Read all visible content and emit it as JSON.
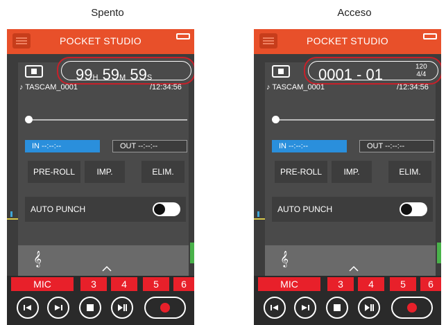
{
  "captions": {
    "left": "Spento",
    "right": "Acceso"
  },
  "app": {
    "title": "POCKET STUDIO"
  },
  "left": {
    "display": {
      "h": "99",
      "h_unit": "H",
      "m": "59",
      "m_unit": "M",
      "s": "59",
      "s_unit": "S"
    },
    "filename": "♪ TASCAM_0001",
    "filetime": "/12:34:56",
    "in_label": "IN  --:--:--",
    "out_label": "OUT  --:--:--",
    "buttons": {
      "preroll": "PRE-ROLL",
      "imp": "IMP.",
      "elim": "ELIM."
    },
    "auto_punch": "AUTO PUNCH",
    "tracks": {
      "mic": "MIC",
      "t3": "3",
      "t4": "4",
      "t5": "5",
      "t6": "6"
    }
  },
  "right": {
    "display": {
      "bar": "0001 - 01",
      "tempo": "120",
      "meter": "4/4"
    },
    "filename": "♪ TASCAM_0001",
    "filetime": "/12:34:56",
    "in_label": "IN  --:--:--",
    "out_label": "OUT  --:--:--",
    "buttons": {
      "preroll": "PRE-ROLL",
      "imp": "IMP.",
      "elim": "ELIM."
    },
    "auto_punch": "AUTO PUNCH",
    "tracks": {
      "mic": "MIC",
      "t3": "3",
      "t4": "4",
      "t5": "5",
      "t6": "6"
    }
  },
  "colors": {
    "accent": "#e8502a",
    "highlight": "#c8202a",
    "in_active": "#2a8fdc",
    "rec": "#e8202a"
  },
  "icons": [
    "menu-icon",
    "battery-icon",
    "stop-icon",
    "tuner-icon",
    "chevron-up-icon",
    "rewind-icon",
    "fast-forward-icon",
    "stop-icon",
    "play-pause-icon",
    "record-icon"
  ]
}
